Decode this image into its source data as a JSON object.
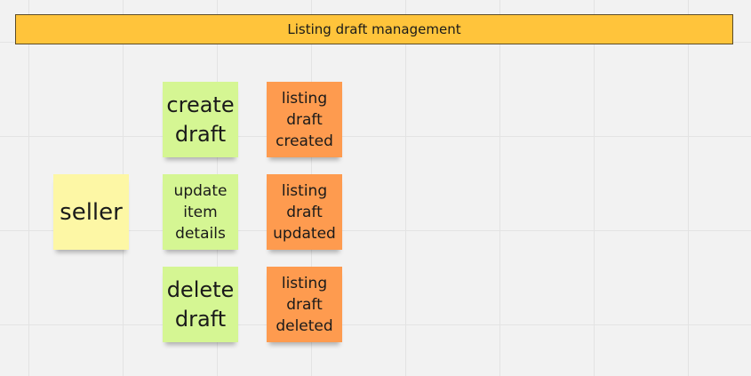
{
  "frame": {
    "title": "Listing draft management"
  },
  "stickies": {
    "seller": "seller",
    "create_draft": "create\ndraft",
    "update_item_details": "update\nitem\ndetails",
    "delete_draft": "delete\ndraft",
    "listing_draft_created": "listing\ndraft\ncreated",
    "listing_draft_updated": "listing\ndraft\nupdated",
    "listing_draft_deleted": "listing\ndraft\ndeleted"
  },
  "colors": {
    "frame": "#ffc43b",
    "actor": "#fdf7a5",
    "command": "#d5f693",
    "event": "#fe9b4f",
    "canvas": "#f2f2f2"
  }
}
